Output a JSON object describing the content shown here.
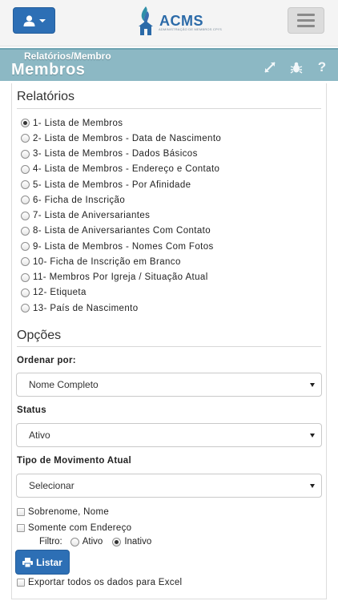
{
  "header": {
    "logo_text": "ACMS",
    "logo_subtitle": "ADMINISTRAÇÃO DE MEMBROS CPI'S"
  },
  "titlebar": {
    "breadcrumb": "Relatórios/Membro",
    "title": "Membros"
  },
  "reports": {
    "section_title": "Relatórios",
    "options": [
      {
        "label": "1- Lista de Membros",
        "checked": true
      },
      {
        "label": "2- Lista de Membros - Data de Nascimento",
        "checked": false
      },
      {
        "label": "3- Lista de Membros - Dados Básicos",
        "checked": false
      },
      {
        "label": "4- Lista de Membros - Endereço e Contato",
        "checked": false
      },
      {
        "label": "5- Lista de Membros - Por Afinidade",
        "checked": false
      },
      {
        "label": "6- Ficha de Inscrição",
        "checked": false
      },
      {
        "label": "7- Lista de Aniversariantes",
        "checked": false
      },
      {
        "label": "8- Lista de Aniversariantes Com Contato",
        "checked": false
      },
      {
        "label": "9- Lista de Membros - Nomes Com Fotos",
        "checked": false
      },
      {
        "label": "10- Ficha de Inscrição em Branco",
        "checked": false
      },
      {
        "label": "11- Membros Por Igreja / Situação Atual",
        "checked": false
      },
      {
        "label": "12- Etiqueta",
        "checked": false
      },
      {
        "label": "13- País de Nascimento",
        "checked": false
      }
    ]
  },
  "options": {
    "section_title": "Opções",
    "order_label": "Ordenar por:",
    "order_value": "Nome Completo",
    "status_label": "Status",
    "status_value": "Ativo",
    "movement_label": "Tipo de Movimento Atual",
    "movement_value": "Selecionar",
    "check_surname": "Sobrenome, Nome",
    "check_address": "Somente com Endereço",
    "filter_label": "Filtro:",
    "filter_active": "Ativo",
    "filter_inactive": "Inativo",
    "filter_selected": "Inativo",
    "list_button": "Listar",
    "export_label": "Exportar todos os dados para Excel"
  },
  "colors": {
    "primary": "#2d6fb5",
    "titlebar": "#8cb8c4"
  }
}
